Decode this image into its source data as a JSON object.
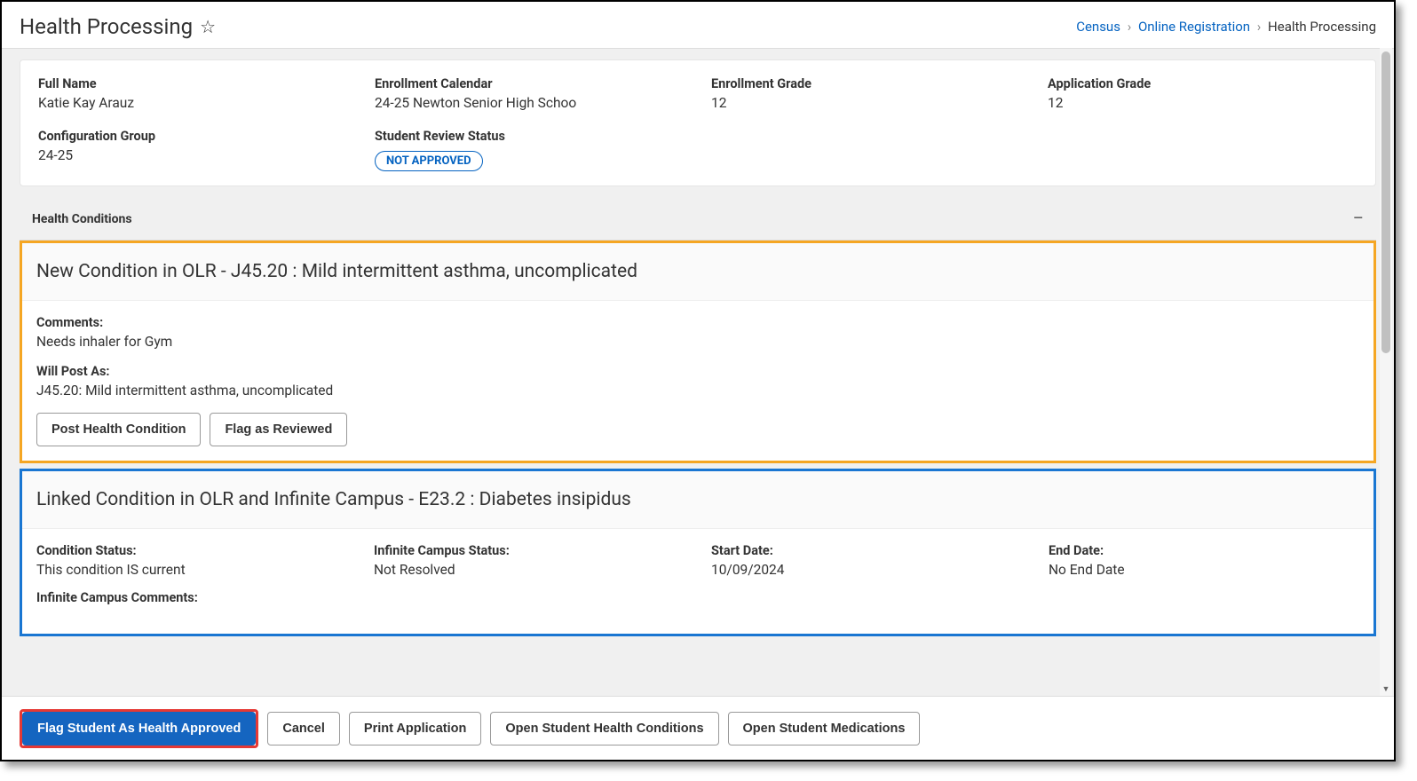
{
  "header": {
    "title": "Health Processing",
    "breadcrumb": {
      "census": "Census",
      "online_reg": "Online Registration",
      "current": "Health Processing"
    }
  },
  "info": {
    "full_name_label": "Full Name",
    "full_name": "Katie Kay Arauz",
    "enrollment_calendar_label": "Enrollment Calendar",
    "enrollment_calendar": "24-25 Newton Senior High Schoo",
    "enrollment_grade_label": "Enrollment Grade",
    "enrollment_grade": "12",
    "application_grade_label": "Application Grade",
    "application_grade": "12",
    "config_group_label": "Configuration Group",
    "config_group": "24-25",
    "review_status_label": "Student Review Status",
    "review_status_badge": "NOT APPROVED"
  },
  "health_section": {
    "header": "Health Conditions"
  },
  "condition1": {
    "title": "New Condition in OLR - J45.20 : Mild intermittent asthma, uncomplicated",
    "comments_label": "Comments:",
    "comments": "Needs inhaler for Gym",
    "will_post_label": "Will Post As:",
    "will_post": "J45.20: Mild intermittent asthma, uncomplicated",
    "btn_post": "Post Health Condition",
    "btn_flag": "Flag as Reviewed"
  },
  "condition2": {
    "title": "Linked Condition in OLR and Infinite Campus - E23.2 : Diabetes insipidus",
    "status_label": "Condition Status:",
    "status": "This condition IS current",
    "ic_status_label": "Infinite Campus Status:",
    "ic_status": "Not Resolved",
    "start_date_label": "Start Date:",
    "start_date": "10/09/2024",
    "end_date_label": "End Date:",
    "end_date": "No End Date",
    "ic_comments_label": "Infinite Campus Comments:"
  },
  "footer": {
    "flag_approved": "Flag Student As Health Approved",
    "cancel": "Cancel",
    "print": "Print Application",
    "open_conditions": "Open Student Health Conditions",
    "open_medications": "Open Student Medications"
  }
}
